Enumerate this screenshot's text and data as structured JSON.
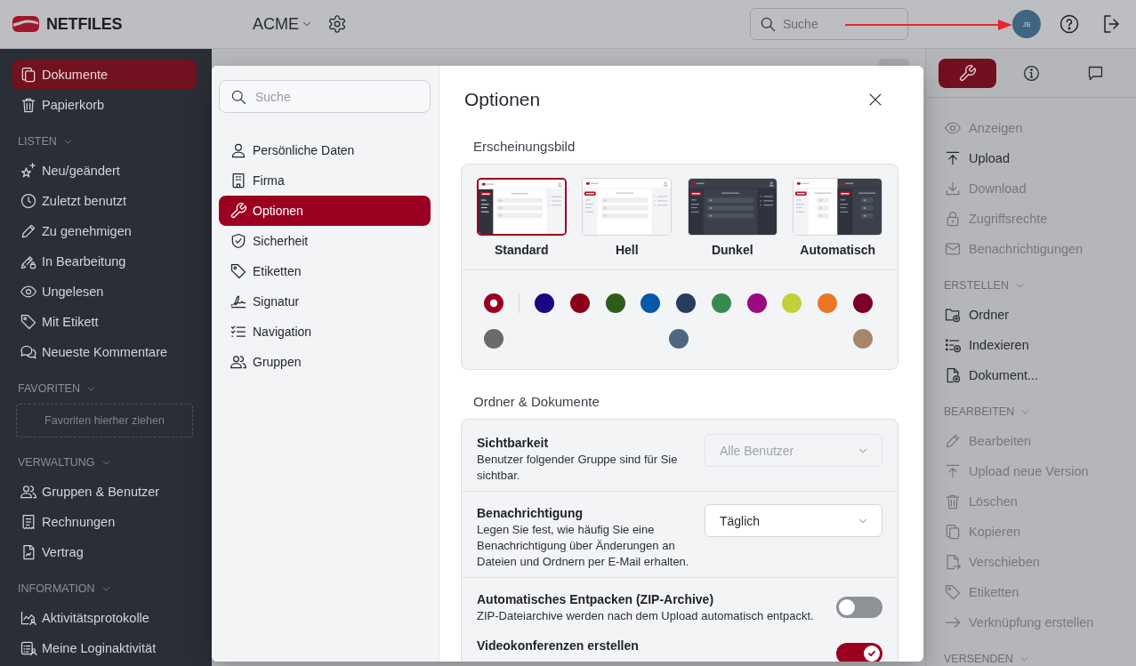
{
  "header": {
    "logo": "NETFILES",
    "workspace": "ACME",
    "search": {
      "placeholder": "Suche"
    },
    "avatar": "JS"
  },
  "sidebar": {
    "items": [
      {
        "label": "Dokumente",
        "selected": true
      },
      {
        "label": "Papierkorb",
        "selected": false
      }
    ],
    "sections": [
      {
        "title": "LISTEN",
        "expanded": true,
        "items": [
          {
            "label": "Neu/geändert",
            "selected": false
          },
          {
            "label": "Zuletzt benutzt",
            "selected": false
          },
          {
            "label": "Zu genehmigen",
            "selected": false
          },
          {
            "label": "In Bearbeitung",
            "selected": false
          },
          {
            "label": "Ungelesen",
            "selected": false
          },
          {
            "label": "Mit Etikett",
            "selected": false
          },
          {
            "label": "Neueste Kommentare",
            "selected": false
          }
        ]
      },
      {
        "title": "FAVORITEN",
        "expanded": true,
        "dropzone": "Favoriten hierher ziehen"
      },
      {
        "title": "VERWALTUNG",
        "expanded": true,
        "items": [
          {
            "label": "Gruppen & Benutzer",
            "selected": false
          },
          {
            "label": "Rechnungen",
            "selected": false
          },
          {
            "label": "Vertrag",
            "selected": false
          }
        ]
      },
      {
        "title": "INFORMATION",
        "expanded": true,
        "items": [
          {
            "label": "Aktivitätsprotokolle",
            "selected": false
          },
          {
            "label": "Meine Loginaktivität",
            "selected": false
          }
        ]
      }
    ]
  },
  "dialog": {
    "search": {
      "placeholder": "Suche"
    },
    "nav": [
      {
        "label": "Persönliche Daten",
        "selected": false
      },
      {
        "label": "Firma",
        "selected": false
      },
      {
        "label": "Optionen",
        "selected": true
      },
      {
        "label": "Sicherheit",
        "selected": false
      },
      {
        "label": "Etiketten",
        "selected": false
      },
      {
        "label": "Signatur",
        "selected": false
      },
      {
        "label": "Navigation",
        "selected": false
      },
      {
        "label": "Gruppen",
        "selected": false
      }
    ],
    "title": "Optionen",
    "appearance": {
      "title": "Erscheinungsbild",
      "themes": [
        {
          "label": "Standard",
          "selected": true
        },
        {
          "label": "Hell",
          "selected": false
        },
        {
          "label": "Dunkel",
          "selected": false
        },
        {
          "label": "Automatisch",
          "selected": false
        }
      ],
      "color_rows": [
        {
          "swatches": [
            {
              "color": "#9b0020",
              "selected": true
            },
            {
              "color": "#1a0680",
              "selected": false
            },
            {
              "color": "#8e0015",
              "selected": false
            },
            {
              "color": "#2d5e17",
              "selected": false
            },
            {
              "color": "#0758a5",
              "selected": false
            },
            {
              "color": "#283c5e",
              "selected": false
            },
            {
              "color": "#3a8a50",
              "selected": false
            },
            {
              "color": "#9b0a80",
              "selected": false
            },
            {
              "color": "#bfd23a",
              "selected": false
            },
            {
              "color": "#ec7429",
              "selected": false
            },
            {
              "color": "#7e0028",
              "selected": false
            }
          ]
        },
        {
          "swatches": [
            {
              "color": "#6a6a6a",
              "selected": false
            },
            {
              "color": "#4d6781",
              "selected": false
            },
            {
              "color": "#a6876a",
              "selected": false
            }
          ]
        }
      ]
    },
    "documents": {
      "title": "Ordner & Dokumente",
      "settings": [
        {
          "kind": "select",
          "title": "Sichtbarkeit",
          "description": "Benutzer folgender Gruppe sind für Sie sichtbar.",
          "value": "Alle Benutzer",
          "disabled": true
        },
        {
          "kind": "select",
          "title": "Benachrichtigung",
          "description": "Legen Sie fest, wie häufig Sie eine Benachrichtigung über Änderungen an Dateien und Ordnern per E-Mail erhalten.",
          "value": "Täglich",
          "disabled": false
        },
        {
          "kind": "toggle",
          "title": "Automatisches Entpacken (ZIP-Archive)",
          "description": "ZIP-Dateiarchive werden nach dem Upload automatisch entpackt.",
          "on": false
        },
        {
          "kind": "toggle",
          "title": "Videokonferenzen erstellen",
          "on": true
        }
      ]
    }
  },
  "action_panel": {
    "tabs": [
      {
        "selected": true
      },
      {
        "selected": false
      },
      {
        "selected": false
      }
    ],
    "items": [
      {
        "label": "Anzeigen",
        "disabled": true
      },
      {
        "label": "Upload",
        "disabled": false
      },
      {
        "label": "Download",
        "disabled": true
      },
      {
        "label": "Zugriffsrechte",
        "disabled": true
      },
      {
        "label": "Benachrichtigungen",
        "disabled": true
      }
    ],
    "sections": [
      {
        "title": "ERSTELLEN",
        "expanded": true,
        "items": [
          {
            "label": "Ordner",
            "disabled": false
          },
          {
            "label": "Indexieren",
            "disabled": false
          },
          {
            "label": "Dokument...",
            "disabled": false
          }
        ]
      },
      {
        "title": "BEARBEITEN",
        "expanded": true,
        "items": [
          {
            "label": "Bearbeiten",
            "disabled": true
          },
          {
            "label": "Upload neue Version",
            "disabled": true
          },
          {
            "label": "Löschen",
            "disabled": true
          },
          {
            "label": "Kopieren",
            "disabled": true
          },
          {
            "label": "Verschieben",
            "disabled": true
          },
          {
            "label": "Etiketten",
            "disabled": true
          },
          {
            "label": "Verknüpfung erstellen",
            "disabled": true
          }
        ]
      },
      {
        "title": "VERSENDEN",
        "expanded": true
      }
    ]
  }
}
